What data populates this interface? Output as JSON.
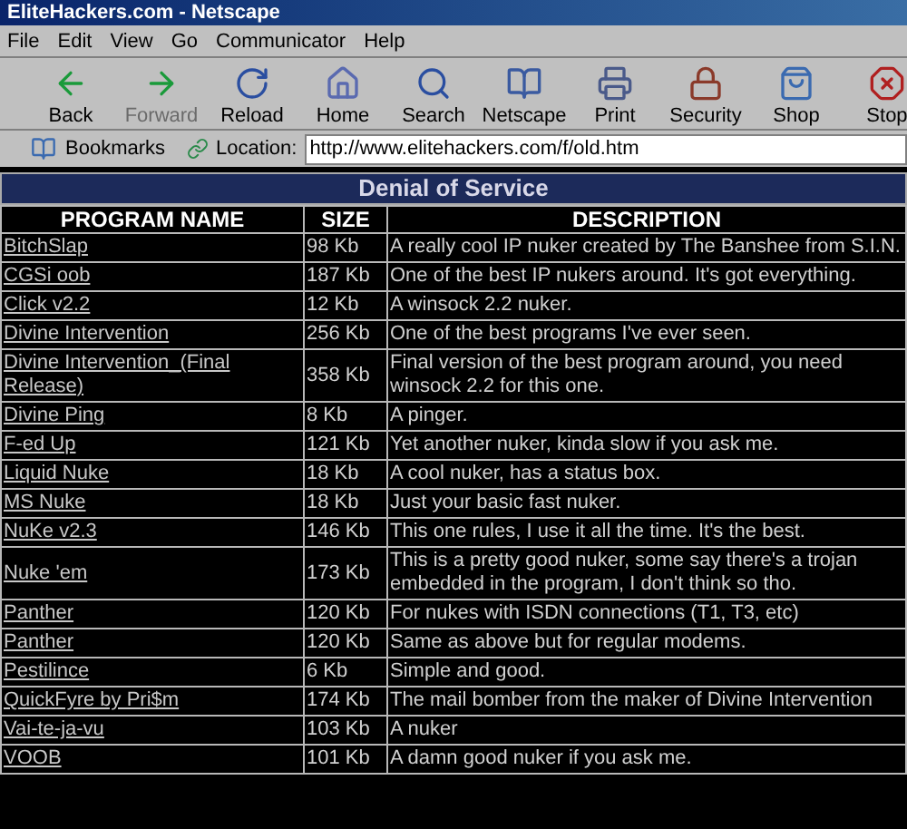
{
  "window": {
    "title": "EliteHackers.com - Netscape"
  },
  "menu": [
    "File",
    "Edit",
    "View",
    "Go",
    "Communicator",
    "Help"
  ],
  "toolbar": [
    {
      "kind": "back",
      "label": "Back",
      "disabled": false
    },
    {
      "kind": "forward",
      "label": "Forward",
      "disabled": true
    },
    {
      "kind": "reload",
      "label": "Reload",
      "disabled": false
    },
    {
      "kind": "home",
      "label": "Home",
      "disabled": false
    },
    {
      "kind": "search",
      "label": "Search",
      "disabled": false
    },
    {
      "kind": "netscape",
      "label": "Netscape",
      "disabled": false
    },
    {
      "kind": "print",
      "label": "Print",
      "disabled": false
    },
    {
      "kind": "security",
      "label": "Security",
      "disabled": false
    },
    {
      "kind": "shop",
      "label": "Shop",
      "disabled": false
    },
    {
      "kind": "stop",
      "label": "Stop",
      "disabled": false
    }
  ],
  "location_bar": {
    "bookmarks": "Bookmarks",
    "label": "Location:",
    "url": "http://www.elitehackers.com/f/old.htm"
  },
  "table": {
    "title": "Denial of Service",
    "columns": [
      "PROGRAM NAME",
      "SIZE",
      "DESCRIPTION"
    ],
    "rows": [
      [
        "BitchSlap",
        "98 Kb",
        "A really cool IP nuker created by The Banshee from S.I.N."
      ],
      [
        "CGSi oob",
        "187 Kb",
        "One of the best IP nukers around. It's got everything."
      ],
      [
        "Click v2.2",
        "12 Kb",
        "A winsock 2.2 nuker."
      ],
      [
        "Divine Intervention",
        "256 Kb",
        "One of the best programs I've ever seen."
      ],
      [
        "Divine Intervention_(Final Release)",
        "358 Kb",
        "Final version of the best program around, you need winsock 2.2 for this one."
      ],
      [
        "Divine Ping",
        "8 Kb",
        "A pinger."
      ],
      [
        "F-ed Up",
        "121 Kb",
        "Yet another nuker, kinda slow if you ask me."
      ],
      [
        "Liquid Nuke",
        "18 Kb",
        "A cool nuker, has a status box."
      ],
      [
        "MS Nuke",
        "18 Kb",
        "Just your basic fast nuker."
      ],
      [
        "NuKe v2.3",
        "146 Kb",
        "This one rules, I use it all the time. It's the best."
      ],
      [
        "Nuke 'em",
        "173 Kb",
        "This is a pretty good nuker, some say there's a trojan embedded in the program, I don't think so tho."
      ],
      [
        "Panther",
        "120 Kb",
        "For nukes with ISDN connections (T1, T3, etc)"
      ],
      [
        "Panther",
        "120 Kb",
        "Same as above but for regular modems."
      ],
      [
        "Pestilince",
        "6 Kb",
        "Simple and good."
      ],
      [
        "QuickFyre by Pri$m",
        "174 Kb",
        "The mail bomber from the maker of Divine Intervention"
      ],
      [
        "Vai-te-ja-vu",
        "103 Kb",
        "A nuker"
      ],
      [
        "VOOB",
        "101 Kb",
        "A damn good nuker if you ask me."
      ]
    ]
  }
}
